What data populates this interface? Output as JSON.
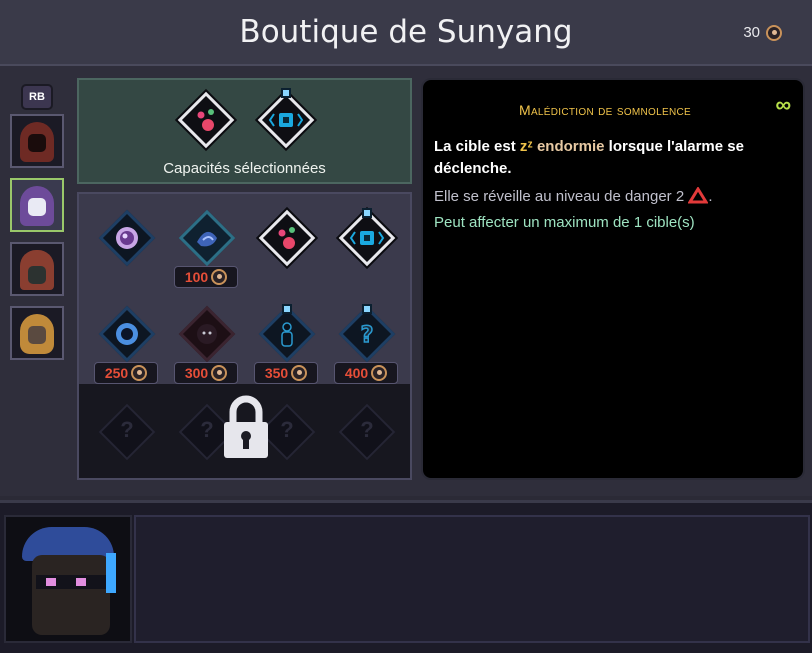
{
  "header": {
    "title": "Boutique de Sunyang",
    "currency_amount": "30",
    "currency_icon": "skull-coin-icon"
  },
  "sidebar": {
    "rb_label": "RB",
    "characters": [
      {
        "name": "hooded-rogue-red",
        "selected": false
      },
      {
        "name": "hooded-mage-purple",
        "selected": true
      },
      {
        "name": "masked-thief-brown",
        "selected": false
      },
      {
        "name": "blonde-agent-masked",
        "selected": false
      }
    ]
  },
  "selected_panel": {
    "label": "Capacités sélectionnées",
    "abilities": [
      "pink-orbs-icon",
      "cyan-core-icon"
    ]
  },
  "shop": {
    "row1": [
      {
        "icon": "purple-eye-icon",
        "price": ""
      },
      {
        "icon": "sleep-curse-icon",
        "price": "100"
      },
      {
        "icon": "pink-orbs-icon",
        "price": ""
      },
      {
        "icon": "cyan-core-icon",
        "price": ""
      }
    ],
    "row2": [
      {
        "icon": "blue-eye-icon",
        "price": "250"
      },
      {
        "icon": "shadow-face-icon",
        "price": "300"
      },
      {
        "icon": "silhouette-icon",
        "price": "350"
      },
      {
        "icon": "question-mark-icon",
        "price": "400"
      }
    ],
    "locked_row": [
      "?",
      "?",
      "?",
      "?"
    ],
    "lock_icon": "padlock-icon"
  },
  "detail": {
    "title": "Malédiction de somnolence",
    "line1_pre": "La cible est",
    "sleep_glyph": "zᶻ",
    "line1_highlight": "endormie",
    "line1_post": "lorsque l'alarme se déclenche.",
    "line2": "Elle se réveille au niveau de danger 2",
    "line2_end": ".",
    "line3": "Peut affecter un maximum de 1 cible(s)",
    "infinity_glyph": "∞"
  },
  "colors": {
    "gold": "#f0c34a",
    "highlight": "#e7c9a3",
    "grey": "#c0c0cc",
    "green": "#9ee3c1",
    "price_red": "#e64e38",
    "danger_red": "#e23a3a"
  }
}
